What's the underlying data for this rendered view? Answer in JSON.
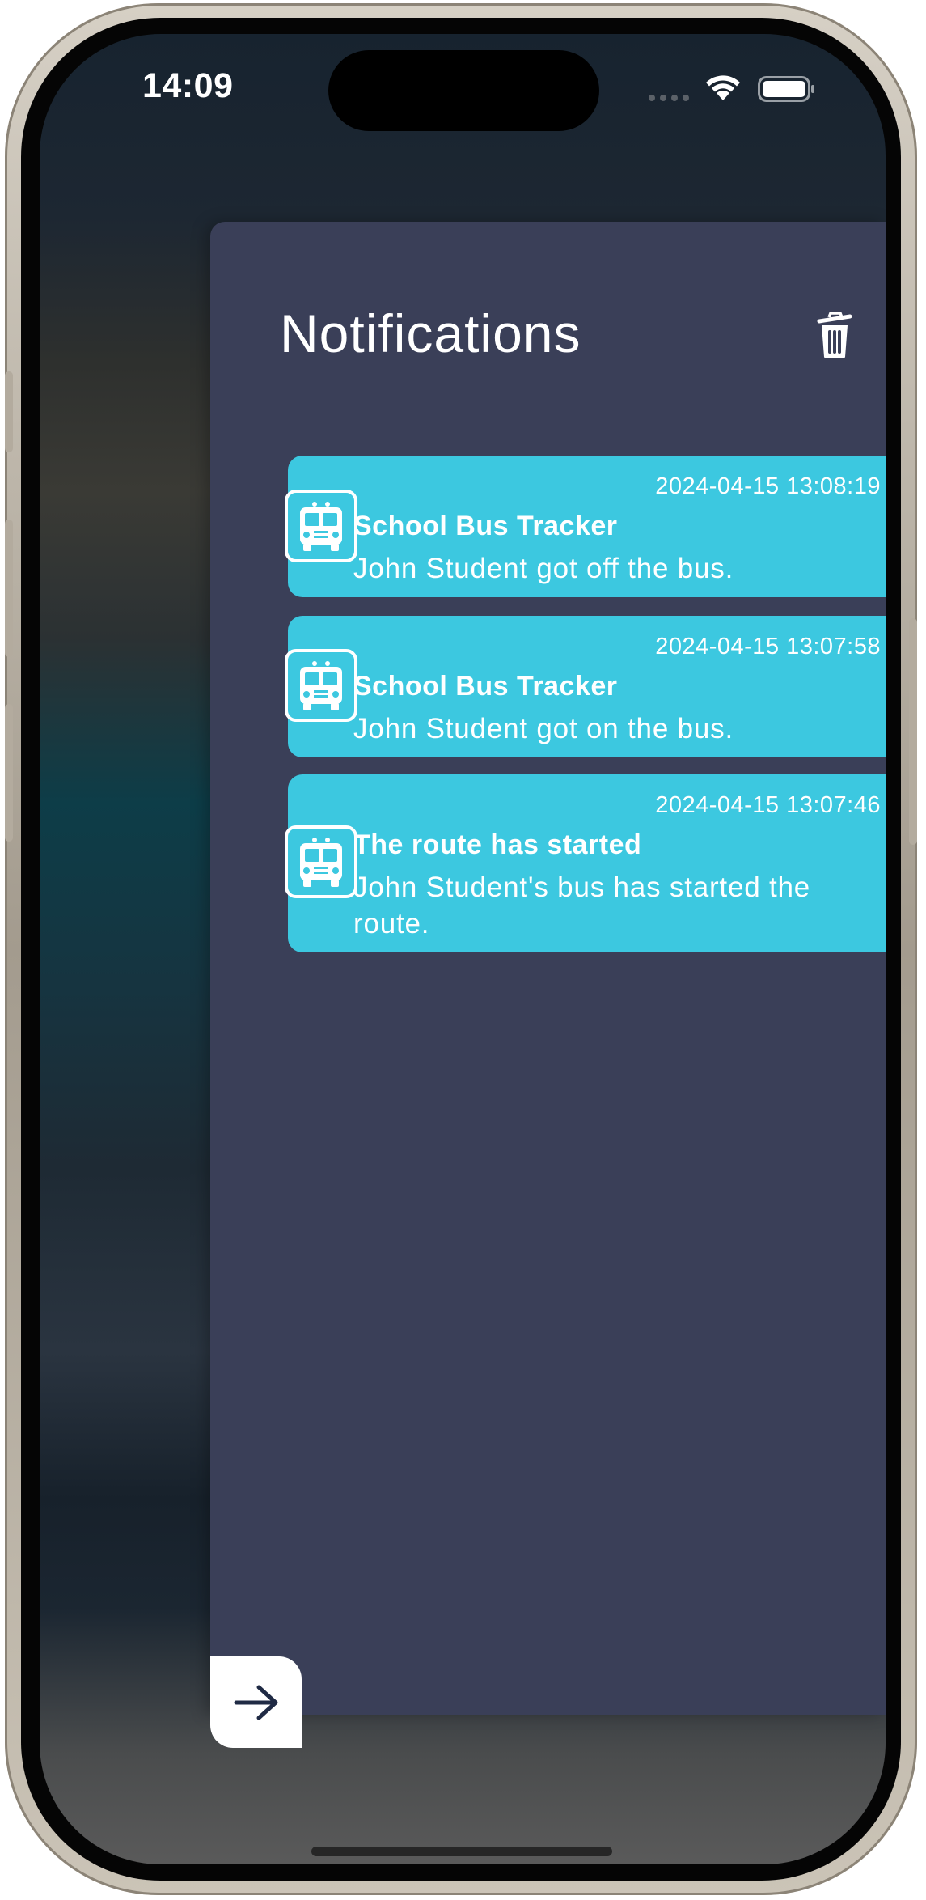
{
  "status_bar": {
    "time": "14:09"
  },
  "drawer": {
    "title": "Notifications",
    "background_color": "#3a3f58",
    "accent_color": "#3cc8e0"
  },
  "notifications": [
    {
      "timestamp": "2024-04-15 13:08:19",
      "title": "School Bus Tracker",
      "body": "John Student got off the bus.",
      "icon": "school-bus-icon"
    },
    {
      "timestamp": "2024-04-15 13:07:58",
      "title": "School Bus Tracker",
      "body": "John Student got on the bus.",
      "icon": "school-bus-icon"
    },
    {
      "timestamp": "2024-04-15 13:07:46",
      "title": "The route has started",
      "body": "John Student's bus has started the route.",
      "icon": "school-bus-icon"
    }
  ],
  "icons": {
    "delete": "trash-icon",
    "close_drawer": "arrow-right-icon",
    "wifi": "wifi-icon",
    "battery": "battery-icon",
    "signal": "signal-dots-icon"
  }
}
